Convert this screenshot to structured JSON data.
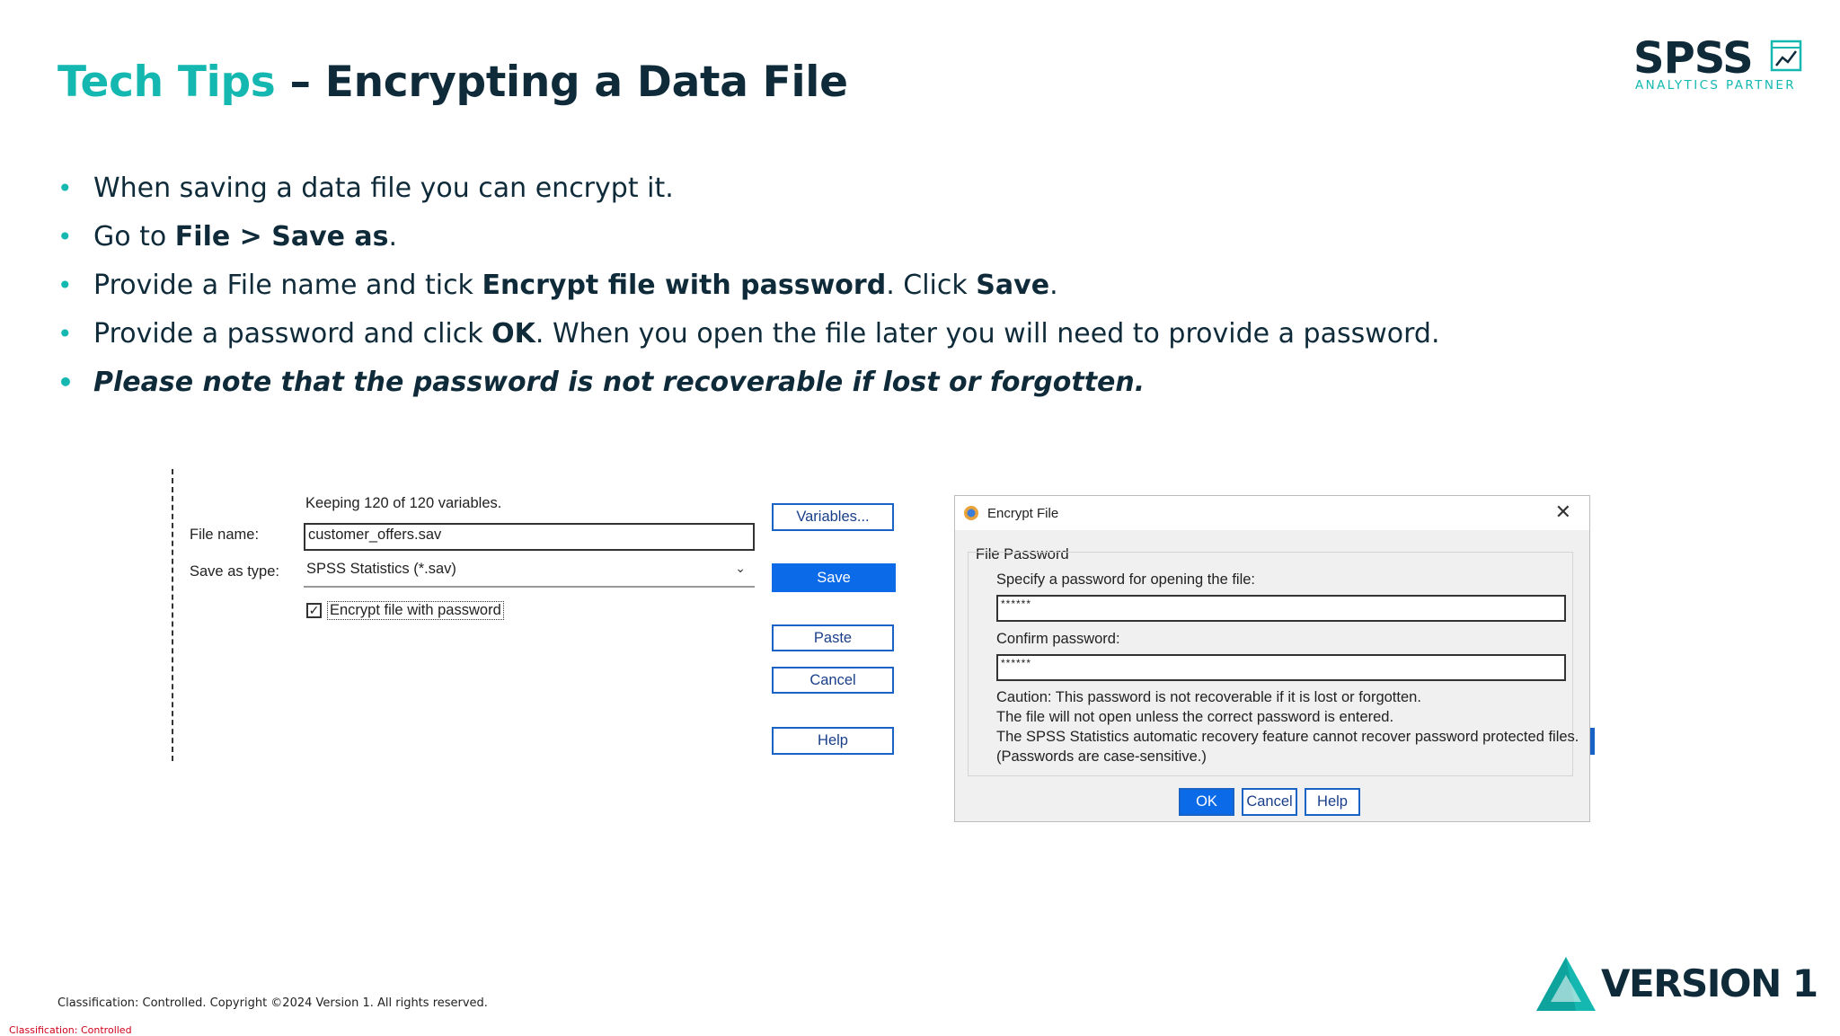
{
  "title": {
    "accent": "Tech Tips",
    "rest": " – Encrypting a Data File"
  },
  "logo": {
    "name": "SPSS",
    "subtitle": "ANALYTICS PARTNER",
    "icon": "chart-icon"
  },
  "bullets": {
    "b1": {
      "text": "When saving a data file you can encrypt it."
    },
    "b2": {
      "pre": "Go to ",
      "bold": "File > Save as",
      "post": "."
    },
    "b3": {
      "pre": "Provide a File name and tick ",
      "bold1": "Encrypt file with password",
      "mid": ". Click ",
      "bold2": "Save",
      "post": "."
    },
    "b4": {
      "pre": "Provide a password and click ",
      "bold": "OK",
      "post": ". When you open the file later you will need to provide a password."
    },
    "b5": {
      "text": "Please note that the password is not recoverable if lost or forgotten."
    }
  },
  "save_dialog": {
    "keeping": "Keeping 120 of 120 variables.",
    "filename_label": "File name:",
    "filename_value": "customer_offers.sav",
    "saveas_label": "Save as type:",
    "saveas_value": "SPSS Statistics (*.sav)",
    "encrypt_label": "Encrypt file with password",
    "encrypt_checked": true,
    "buttons": {
      "variables": "Variables...",
      "save": "Save",
      "paste": "Paste",
      "cancel": "Cancel",
      "help": "Help"
    }
  },
  "encrypt_dialog": {
    "title": "Encrypt File",
    "group_label": "File Password",
    "specify_label": "Specify a password for opening the file:",
    "password_value": "******",
    "confirm_label": "Confirm password:",
    "confirm_value": "******",
    "caution": [
      "Caution: This password is not recoverable if it is lost or forgotten.",
      "The file will not open unless the correct password is entered.",
      "The SPSS Statistics automatic recovery feature cannot recover password protected files.",
      "(Passwords are case-sensitive.)"
    ],
    "buttons": {
      "ok": "OK",
      "cancel": "Cancel",
      "help": "Help"
    }
  },
  "footer": {
    "copyright": "Classification: Controlled. Copyright ©2024 Version 1. All rights reserved.",
    "classification": "Classification: Controlled",
    "brand": "VERSION 1"
  },
  "colors": {
    "accent": "#14b8b0",
    "navy": "#0f2b3a",
    "button_blue": "#0a6ae8",
    "classification_red": "#d0021b"
  }
}
